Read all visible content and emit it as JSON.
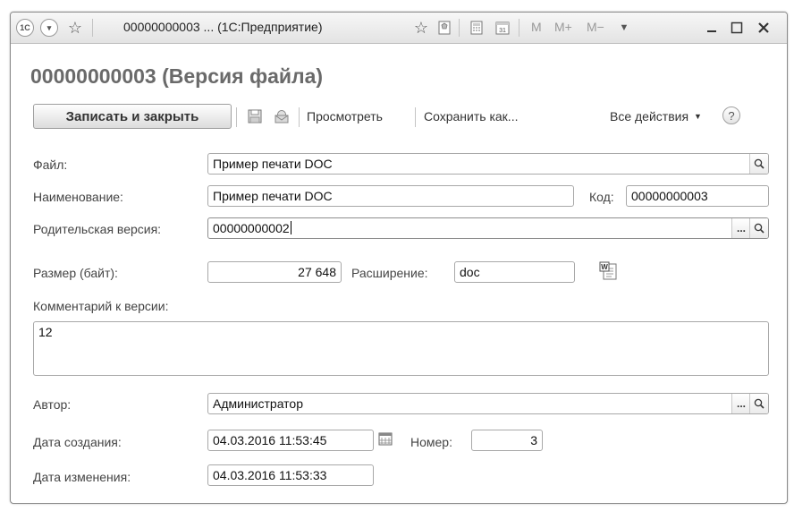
{
  "window": {
    "title": "00000000003 ... (1С:Предприятие)",
    "memory_buttons": [
      "M",
      "M+",
      "M−"
    ]
  },
  "icons": {
    "app": "1c-logo-icon",
    "nav_menu": "dropdown-circle-icon",
    "favorite": "star-icon",
    "add_favorite": "star-add-icon",
    "bookmark": "bookmark-icon",
    "calculator": "calculator-icon",
    "calendar": "calendar-icon",
    "save": "floppy-disk-icon",
    "mail": "envelope-icon",
    "help": "help-icon",
    "word_doc": "word-document-icon",
    "search": "magnifier-icon",
    "select": "ellipsis-icon"
  },
  "form": {
    "title": "00000000003 (Версия файла)",
    "toolbar": {
      "save_close": "Записать и закрыть",
      "view": "Просмотреть",
      "save_as": "Сохранить как...",
      "all_actions": "Все действия",
      "all_actions_arrow": "▼",
      "help": "?"
    },
    "file": {
      "label": "Файл:",
      "value": "Пример печати DOC"
    },
    "name": {
      "label": "Наименование:",
      "value": "Пример печати DOC"
    },
    "code": {
      "label": "Код:",
      "value": "00000000003"
    },
    "parent_version": {
      "label": "Родительская версия:",
      "value": "00000000002"
    },
    "size": {
      "label": "Размер (байт):",
      "value": "27 648"
    },
    "extension": {
      "label": "Расширение:",
      "value": "doc"
    },
    "comment": {
      "label": "Комментарий к версии:",
      "value": "12"
    },
    "author": {
      "label": "Автор:",
      "value": "Администратор"
    },
    "created": {
      "label": "Дата создания:",
      "value": "04.03.2016 11:53:45"
    },
    "number": {
      "label": "Номер:",
      "value": "3"
    },
    "modified": {
      "label": "Дата изменения:",
      "value": "04.03.2016 11:53:33"
    },
    "field_buttons": {
      "ellipsis": "...",
      "search": "🔍"
    }
  }
}
